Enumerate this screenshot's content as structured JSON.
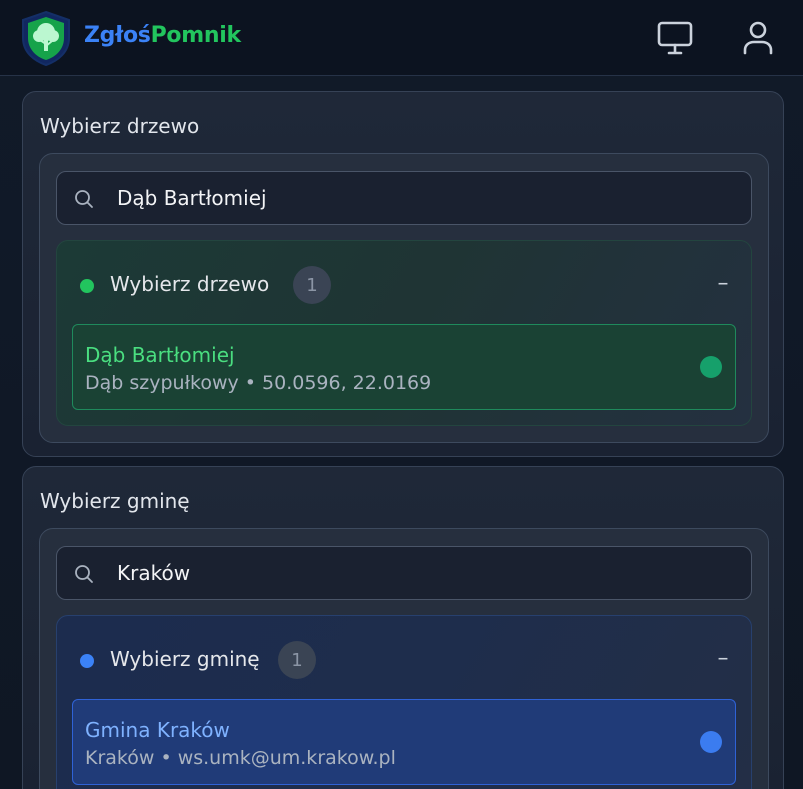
{
  "header": {
    "brand_part1": "Zgłoś",
    "brand_part2": "Pomnik",
    "icons": {
      "logo": "shield-tree-logo",
      "monitor": "monitor-icon",
      "user": "user-icon"
    }
  },
  "tree_section": {
    "title": "Wybierz drzewo",
    "search_value": "Dąb Bartłomiej",
    "group": {
      "label": "Wybierz drzewo",
      "count": "1",
      "collapse_symbol": "–"
    },
    "item": {
      "title": "Dąb Bartłomiej",
      "subtitle": "Dąb szypułkowy • 50.0596, 22.0169"
    }
  },
  "gmina_section": {
    "title": "Wybierz gminę",
    "search_value": "Kraków",
    "group": {
      "label": "Wybierz gminę",
      "count": "1",
      "collapse_symbol": "–"
    },
    "item": {
      "title": "Gmina Kraków",
      "subtitle": "Kraków • ws.umk@um.krakow.pl"
    }
  },
  "colors": {
    "brand_blue": "#3b82f6",
    "brand_green": "#22c55e",
    "selected_green": "#16a06b",
    "selected_blue": "#3b7cf0"
  }
}
